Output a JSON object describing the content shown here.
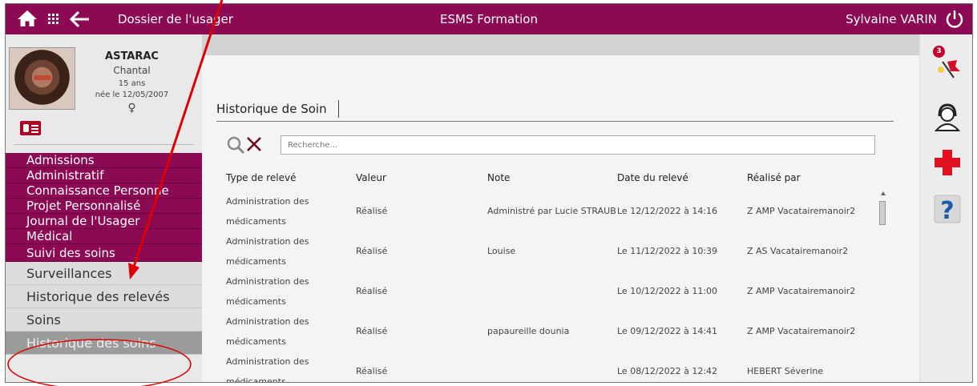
{
  "topbar": {
    "breadcrumb": "Dossier de l'usager",
    "title": "ESMS Formation",
    "user": "Sylvaine VARIN"
  },
  "patient": {
    "last_name": "ASTARAC",
    "first_name": "Chantal",
    "age": "15 ans",
    "birth": "née le 12/05/2007",
    "gender_symbol": "♀"
  },
  "menu": {
    "items": [
      {
        "label": "Admissions"
      },
      {
        "label": "Administratif"
      },
      {
        "label": "Connaissance Personne"
      },
      {
        "label": "Projet Personnalisé"
      },
      {
        "label": "Journal de l'Usager"
      },
      {
        "label": "Médical"
      },
      {
        "label": "Suivi des soins"
      }
    ],
    "subitems": [
      {
        "label": "Surveillances"
      },
      {
        "label": "Historique des relevés"
      },
      {
        "label": "Soins"
      },
      {
        "label": "Historique des soins"
      }
    ]
  },
  "main": {
    "page_title": "Historique de Soin",
    "search_placeholder": "Recherche...",
    "columns": [
      "Type de relevé",
      "Valeur",
      "Note",
      "Date du relevé",
      "Réalisé par"
    ],
    "rows": [
      {
        "type_line1": "Administration des",
        "type_line2": "médicaments",
        "valeur": "Réalisé",
        "note": "Administré par Lucie STRAUB",
        "date": "Le 12/12/2022 à 14:16",
        "par": "Z AMP Vacatairemanoir2"
      },
      {
        "type_line1": "Administration des",
        "type_line2": "médicaments",
        "valeur": "Réalisé",
        "note": "Louise",
        "date": "Le 11/12/2022 à 10:39",
        "par": "Z AS Vacatairemanoir2"
      },
      {
        "type_line1": "Administration des",
        "type_line2": "médicaments",
        "valeur": "Réalisé",
        "note": "",
        "date": "Le 10/12/2022 à 11:00",
        "par": "Z AMP Vacatairemanoir2"
      },
      {
        "type_line1": "Administration des",
        "type_line2": "médicaments",
        "valeur": "Réalisé",
        "note": "papaureille dounia",
        "date": "Le 09/12/2022 à 14:41",
        "par": "Z AMP Vacatairemanoir2"
      },
      {
        "type_line1": "Administration des",
        "type_line2": "médicaments",
        "valeur": "Réalisé",
        "note": "",
        "date": "Le 08/12/2022 à 12:42",
        "par": "HEBERT Séverine"
      }
    ]
  },
  "rail": {
    "alert_count": "3",
    "help_symbol": "?"
  },
  "colors": {
    "brand": "#8c0a54",
    "annotation": "#e00000"
  }
}
